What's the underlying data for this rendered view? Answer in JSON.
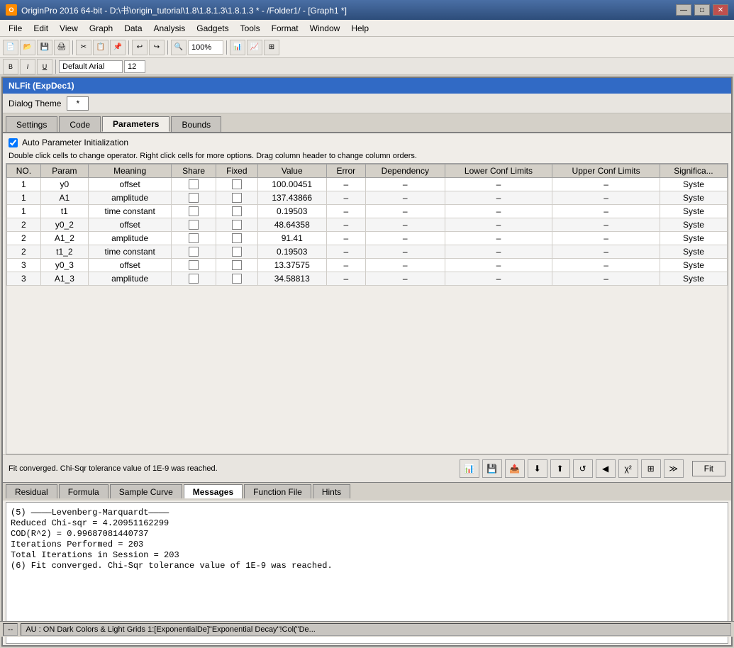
{
  "titlebar": {
    "icon": "O",
    "title": "OriginPro 2016 64-bit - D:\\书\\origin_tutorial\\1.8\\1.8.1.3\\1.8.1.3 * - /Folder1/ - [Graph1 *]",
    "min": "—",
    "max": "□",
    "close": "✕"
  },
  "menu": {
    "items": [
      "File",
      "Edit",
      "View",
      "Graph",
      "Data",
      "Analysis",
      "Gadgets",
      "Tools",
      "Format",
      "Window",
      "Help"
    ]
  },
  "toolbar": {
    "zoom": "100%"
  },
  "dialog": {
    "title": "NLFit (ExpDec1)",
    "theme_label": "Dialog Theme",
    "theme_value": "*"
  },
  "tabs": {
    "items": [
      "Settings",
      "Code",
      "Parameters",
      "Bounds"
    ],
    "active": "Parameters"
  },
  "auto_param": {
    "label": "Auto Parameter Initialization",
    "checked": true
  },
  "hint": "Double click cells to change operator. Right click cells for more options. Drag column header to change column orders.",
  "table": {
    "headers": [
      "NO.",
      "Param",
      "Meaning",
      "Share",
      "Fixed",
      "Value",
      "Error",
      "Dependency",
      "Lower Conf Limits",
      "Upper Conf Limits",
      "Significa..."
    ],
    "rows": [
      {
        "no": "1",
        "param": "y0",
        "meaning": "offset",
        "share": false,
        "fixed": false,
        "value": "100.00451",
        "error": "–",
        "dep": "–",
        "lower": "–",
        "upper": "–",
        "sig": "Syste"
      },
      {
        "no": "1",
        "param": "A1",
        "meaning": "amplitude",
        "share": false,
        "fixed": false,
        "value": "137.43866",
        "error": "–",
        "dep": "–",
        "lower": "–",
        "upper": "–",
        "sig": "Syste"
      },
      {
        "no": "1",
        "param": "t1",
        "meaning": "time constant",
        "share": false,
        "fixed": false,
        "value": "0.19503",
        "error": "–",
        "dep": "–",
        "lower": "–",
        "upper": "–",
        "sig": "Syste"
      },
      {
        "no": "2",
        "param": "y0_2",
        "meaning": "offset",
        "share": false,
        "fixed": false,
        "value": "48.64358",
        "error": "–",
        "dep": "–",
        "lower": "–",
        "upper": "–",
        "sig": "Syste"
      },
      {
        "no": "2",
        "param": "A1_2",
        "meaning": "amplitude",
        "share": false,
        "fixed": false,
        "value": "91.41",
        "error": "–",
        "dep": "–",
        "lower": "–",
        "upper": "–",
        "sig": "Syste"
      },
      {
        "no": "2",
        "param": "t1_2",
        "meaning": "time constant",
        "share": false,
        "fixed": false,
        "value": "0.19503",
        "error": "–",
        "dep": "–",
        "lower": "–",
        "upper": "–",
        "sig": "Syste"
      },
      {
        "no": "3",
        "param": "y0_3",
        "meaning": "offset",
        "share": false,
        "fixed": false,
        "value": "13.37575",
        "error": "–",
        "dep": "–",
        "lower": "–",
        "upper": "–",
        "sig": "Syste"
      },
      {
        "no": "3",
        "param": "A1_3",
        "meaning": "amplitude",
        "share": false,
        "fixed": false,
        "value": "34.58813",
        "error": "–",
        "dep": "–",
        "lower": "–",
        "upper": "–",
        "sig": "Syste"
      }
    ]
  },
  "status": {
    "text": "Fit converged. Chi-Sqr tolerance value of 1E-9 was reached."
  },
  "fit_button": "Fit",
  "subtabs": {
    "items": [
      "Residual",
      "Formula",
      "Sample Curve",
      "Messages",
      "Function File",
      "Hints"
    ],
    "active": "Messages"
  },
  "messages": {
    "lines": [
      "(5) ————Levenberg-Marquardt————",
      "Reduced Chi-sqr = 4.20951162299",
      "COD(R^2) = 0.99687081440737",
      "Iterations Performed = 203",
      "Total Iterations in Session = 203",
      "(6) Fit converged. Chi-Sqr tolerance value of 1E-9 was reached."
    ]
  },
  "statusbar": {
    "left": "--",
    "middle": "AU : ON  Dark Colors & Light Grids  1:[ExponentialDe]\"Exponential Decay\"!Col(\"De..."
  },
  "icons": {
    "toolbar_icons": [
      "📁",
      "💾",
      "🖨️",
      "✂️",
      "📋",
      "↩",
      "↪",
      "🔍",
      "📊"
    ]
  }
}
